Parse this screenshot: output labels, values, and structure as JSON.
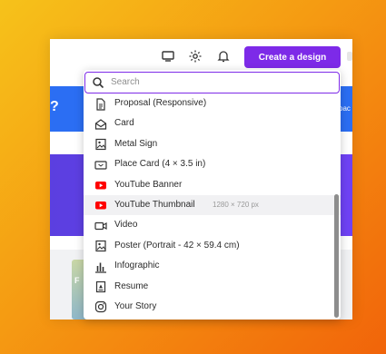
{
  "toolbar": {
    "create_label": "Create a design",
    "icons": [
      "present-icon",
      "settings-icon",
      "bell-icon"
    ]
  },
  "background": {
    "left_fragment": "?",
    "right_fragment": "oac",
    "card_fragment": "F"
  },
  "search": {
    "placeholder": "Search",
    "value": ""
  },
  "items": [
    {
      "label": "Proposal (Responsive)",
      "icon": "document-icon"
    },
    {
      "label": "Card",
      "icon": "envelope-icon"
    },
    {
      "label": "Metal Sign",
      "icon": "image-frame-icon"
    },
    {
      "label": "Place Card (4 × 3.5 in)",
      "icon": "place-card-icon"
    },
    {
      "label": "YouTube Banner",
      "icon": "youtube-icon"
    },
    {
      "label": "YouTube Thumbnail",
      "dimensions": "1280 × 720 px",
      "icon": "youtube-icon",
      "highlighted": true
    },
    {
      "label": "Video",
      "icon": "video-camera-icon"
    },
    {
      "label": "Poster (Portrait - 42 × 59.4 cm)",
      "icon": "image-frame-icon"
    },
    {
      "label": "Infographic",
      "icon": "bar-chart-icon"
    },
    {
      "label": "Resume",
      "icon": "resume-icon"
    },
    {
      "label": "Your Story",
      "icon": "instagram-icon"
    }
  ],
  "colors": {
    "accent": "#7d2ae8",
    "youtube": "#ff0000"
  }
}
